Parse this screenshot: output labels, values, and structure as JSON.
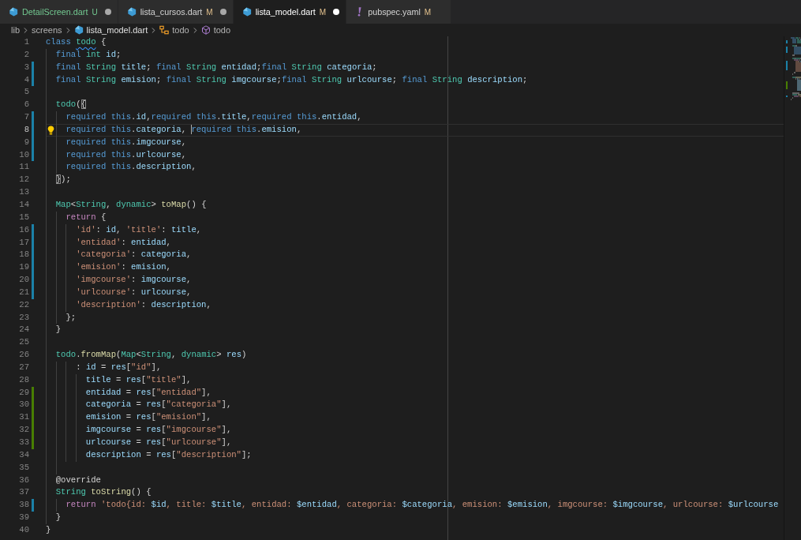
{
  "tabs": [
    {
      "kind": "dart",
      "label": "DetailScreen.dart",
      "status": "U",
      "untracked": true,
      "dirty": true,
      "selected": false
    },
    {
      "kind": "dart",
      "label": "lista_cursos.dart",
      "status": "M",
      "untracked": false,
      "dirty": true,
      "selected": false
    },
    {
      "kind": "dart",
      "label": "lista_model.dart",
      "status": "M",
      "untracked": false,
      "dirty": true,
      "selected": true
    },
    {
      "kind": "yaml",
      "label": "pubspec.yaml",
      "status": "M",
      "untracked": false,
      "dirty": false,
      "selected": false
    }
  ],
  "breadcrumb": [
    {
      "kind": "folder",
      "text": "lib"
    },
    {
      "kind": "folder",
      "text": "screens"
    },
    {
      "kind": "file",
      "text": "lista_model.dart"
    },
    {
      "kind": "class",
      "text": "todo"
    },
    {
      "kind": "constructor",
      "text": "todo"
    }
  ],
  "editor": {
    "lines": [
      {
        "number": "1",
        "kind": "plain",
        "current": false,
        "tokens": [
          {
            "kind": "kw",
            "text": "class "
          },
          {
            "kind": "type",
            "text": "todo",
            "squiggle": true
          },
          {
            "kind": "punct",
            "text": " {"
          }
        ]
      },
      {
        "number": "2",
        "kind": "plain",
        "current": false,
        "tokens": [
          {
            "kind": "kw",
            "text": "  final "
          },
          {
            "kind": "type",
            "text": "int "
          },
          {
            "kind": "var",
            "text": "id"
          },
          {
            "kind": "punct",
            "text": ";"
          }
        ]
      },
      {
        "number": "3",
        "kind": "modified",
        "current": false,
        "tokens": [
          {
            "kind": "kw",
            "text": "  final "
          },
          {
            "kind": "type",
            "text": "String "
          },
          {
            "kind": "var",
            "text": "title"
          },
          {
            "kind": "punct",
            "text": "; "
          },
          {
            "kind": "kw",
            "text": "final "
          },
          {
            "kind": "type",
            "text": "String "
          },
          {
            "kind": "var",
            "text": "entidad"
          },
          {
            "kind": "punct",
            "text": ";"
          },
          {
            "kind": "kw",
            "text": "final "
          },
          {
            "kind": "type",
            "text": "String "
          },
          {
            "kind": "var",
            "text": "categoria"
          },
          {
            "kind": "punct",
            "text": ";"
          }
        ]
      },
      {
        "number": "4",
        "kind": "modified",
        "current": false,
        "tokens": [
          {
            "kind": "kw",
            "text": "  final "
          },
          {
            "kind": "type",
            "text": "String "
          },
          {
            "kind": "var",
            "text": "emision"
          },
          {
            "kind": "punct",
            "text": "; "
          },
          {
            "kind": "kw",
            "text": "final "
          },
          {
            "kind": "type",
            "text": "String "
          },
          {
            "kind": "var",
            "text": "imgcourse"
          },
          {
            "kind": "punct",
            "text": ";"
          },
          {
            "kind": "kw",
            "text": "final "
          },
          {
            "kind": "type",
            "text": "String "
          },
          {
            "kind": "var",
            "text": "urlcourse"
          },
          {
            "kind": "punct",
            "text": "; "
          },
          {
            "kind": "kw",
            "text": "final "
          },
          {
            "kind": "type",
            "text": "String "
          },
          {
            "kind": "var",
            "text": "description"
          },
          {
            "kind": "punct",
            "text": ";"
          }
        ]
      },
      {
        "number": "5",
        "kind": "plain",
        "current": false
      },
      {
        "number": "6",
        "kind": "plain",
        "current": false,
        "tokens": [
          {
            "kind": "type",
            "text": "  todo"
          },
          {
            "kind": "punct",
            "text": "("
          },
          {
            "kind": "punct",
            "text": "{",
            "matched": true
          }
        ]
      },
      {
        "number": "7",
        "kind": "modified",
        "current": false,
        "tokens": [
          {
            "kind": "kw",
            "text": "    required this"
          },
          {
            "kind": "punct",
            "text": "."
          },
          {
            "kind": "var",
            "text": "id"
          },
          {
            "kind": "punct",
            "text": ","
          },
          {
            "kind": "kw",
            "text": "required this"
          },
          {
            "kind": "punct",
            "text": "."
          },
          {
            "kind": "var",
            "text": "title"
          },
          {
            "kind": "punct",
            "text": ","
          },
          {
            "kind": "kw",
            "text": "required this"
          },
          {
            "kind": "punct",
            "text": "."
          },
          {
            "kind": "var",
            "text": "entidad"
          },
          {
            "kind": "punct",
            "text": ","
          }
        ]
      },
      {
        "number": "8",
        "kind": "modified",
        "current": true,
        "lightbulb": true,
        "tokens": [
          {
            "kind": "kw",
            "text": "    required this"
          },
          {
            "kind": "punct",
            "text": "."
          },
          {
            "kind": "var",
            "text": "categoria"
          },
          {
            "kind": "punct",
            "text": ", "
          },
          {
            "kind": "kw",
            "text": "required this",
            "cursor": true
          },
          {
            "kind": "punct",
            "text": "."
          },
          {
            "kind": "var",
            "text": "emision"
          },
          {
            "kind": "punct",
            "text": ","
          }
        ]
      },
      {
        "number": "9",
        "kind": "modified",
        "current": false,
        "tokens": [
          {
            "kind": "kw",
            "text": "    required this"
          },
          {
            "kind": "punct",
            "text": "."
          },
          {
            "kind": "var",
            "text": "imgcourse"
          },
          {
            "kind": "punct",
            "text": ","
          }
        ]
      },
      {
        "number": "10",
        "kind": "modified",
        "current": false,
        "tokens": [
          {
            "kind": "kw",
            "text": "    required this"
          },
          {
            "kind": "punct",
            "text": "."
          },
          {
            "kind": "var",
            "text": "urlcourse"
          },
          {
            "kind": "punct",
            "text": ","
          }
        ]
      },
      {
        "number": "11",
        "kind": "plain",
        "current": false,
        "tokens": [
          {
            "kind": "kw",
            "text": "    required this"
          },
          {
            "kind": "punct",
            "text": "."
          },
          {
            "kind": "var",
            "text": "description"
          },
          {
            "kind": "punct",
            "text": ","
          }
        ]
      },
      {
        "number": "12",
        "kind": "plain",
        "current": false,
        "tokens": [
          {
            "kind": "punct",
            "text": "  }",
            "matched": true
          },
          {
            "kind": "punct",
            "text": ");"
          }
        ]
      },
      {
        "number": "13",
        "kind": "plain",
        "current": false
      },
      {
        "number": "14",
        "kind": "plain",
        "current": false,
        "tokens": [
          {
            "kind": "type",
            "text": "  Map"
          },
          {
            "kind": "punct",
            "text": "<"
          },
          {
            "kind": "type",
            "text": "String"
          },
          {
            "kind": "punct",
            "text": ", "
          },
          {
            "kind": "type",
            "text": "dynamic"
          },
          {
            "kind": "punct",
            "text": "> "
          },
          {
            "kind": "fn",
            "text": "toMap"
          },
          {
            "kind": "punct",
            "text": "() {"
          }
        ]
      },
      {
        "number": "15",
        "kind": "plain",
        "current": false,
        "tokens": [
          {
            "kind": "ctl",
            "text": "    return"
          },
          {
            "kind": "punct",
            "text": " {"
          }
        ]
      },
      {
        "number": "16",
        "kind": "modified",
        "current": false,
        "tokens": [
          {
            "kind": "str",
            "text": "      'id'"
          },
          {
            "kind": "punct",
            "text": ": "
          },
          {
            "kind": "var",
            "text": "id"
          },
          {
            "kind": "punct",
            "text": ", "
          },
          {
            "kind": "str",
            "text": "'title'"
          },
          {
            "kind": "punct",
            "text": ": "
          },
          {
            "kind": "var",
            "text": "title"
          },
          {
            "kind": "punct",
            "text": ","
          }
        ]
      },
      {
        "number": "17",
        "kind": "modified",
        "current": false,
        "tokens": [
          {
            "kind": "str",
            "text": "      'entidad'"
          },
          {
            "kind": "punct",
            "text": ": "
          },
          {
            "kind": "var",
            "text": "entidad"
          },
          {
            "kind": "punct",
            "text": ","
          }
        ]
      },
      {
        "number": "18",
        "kind": "modified",
        "current": false,
        "tokens": [
          {
            "kind": "str",
            "text": "      'categoria'"
          },
          {
            "kind": "punct",
            "text": ": "
          },
          {
            "kind": "var",
            "text": "categoria"
          },
          {
            "kind": "punct",
            "text": ","
          }
        ]
      },
      {
        "number": "19",
        "kind": "modified",
        "current": false,
        "tokens": [
          {
            "kind": "str",
            "text": "      'emision'"
          },
          {
            "kind": "punct",
            "text": ": "
          },
          {
            "kind": "var",
            "text": "emision"
          },
          {
            "kind": "punct",
            "text": ","
          }
        ]
      },
      {
        "number": "20",
        "kind": "modified",
        "current": false,
        "tokens": [
          {
            "kind": "str",
            "text": "      'imgcourse'"
          },
          {
            "kind": "punct",
            "text": ": "
          },
          {
            "kind": "var",
            "text": "imgcourse"
          },
          {
            "kind": "punct",
            "text": ","
          }
        ]
      },
      {
        "number": "21",
        "kind": "modified",
        "current": false,
        "tokens": [
          {
            "kind": "str",
            "text": "      'urlcourse'"
          },
          {
            "kind": "punct",
            "text": ": "
          },
          {
            "kind": "var",
            "text": "urlcourse"
          },
          {
            "kind": "punct",
            "text": ","
          }
        ]
      },
      {
        "number": "22",
        "kind": "plain",
        "current": false,
        "tokens": [
          {
            "kind": "str",
            "text": "      'description'"
          },
          {
            "kind": "punct",
            "text": ": "
          },
          {
            "kind": "var",
            "text": "description"
          },
          {
            "kind": "punct",
            "text": ","
          }
        ]
      },
      {
        "number": "23",
        "kind": "plain",
        "current": false,
        "tokens": [
          {
            "kind": "punct",
            "text": "    };"
          }
        ]
      },
      {
        "number": "24",
        "kind": "plain",
        "current": false,
        "tokens": [
          {
            "kind": "punct",
            "text": "  }"
          }
        ]
      },
      {
        "number": "25",
        "kind": "plain",
        "current": false
      },
      {
        "number": "26",
        "kind": "plain",
        "current": false,
        "tokens": [
          {
            "kind": "type",
            "text": "  todo"
          },
          {
            "kind": "punct",
            "text": "."
          },
          {
            "kind": "fn",
            "text": "fromMap"
          },
          {
            "kind": "punct",
            "text": "("
          },
          {
            "kind": "type",
            "text": "Map"
          },
          {
            "kind": "punct",
            "text": "<"
          },
          {
            "kind": "type",
            "text": "String"
          },
          {
            "kind": "punct",
            "text": ", "
          },
          {
            "kind": "type",
            "text": "dynamic"
          },
          {
            "kind": "punct",
            "text": "> "
          },
          {
            "kind": "var",
            "text": "res"
          },
          {
            "kind": "punct",
            "text": ")"
          }
        ]
      },
      {
        "number": "27",
        "kind": "plain",
        "current": false,
        "tokens": [
          {
            "kind": "punct",
            "text": "      : "
          },
          {
            "kind": "var",
            "text": "id"
          },
          {
            "kind": "punct",
            "text": " = "
          },
          {
            "kind": "var",
            "text": "res"
          },
          {
            "kind": "punct",
            "text": "["
          },
          {
            "kind": "str",
            "text": "\"id\""
          },
          {
            "kind": "punct",
            "text": "],"
          }
        ]
      },
      {
        "number": "28",
        "kind": "plain",
        "current": false,
        "tokens": [
          {
            "kind": "var",
            "text": "        title"
          },
          {
            "kind": "punct",
            "text": " = "
          },
          {
            "kind": "var",
            "text": "res"
          },
          {
            "kind": "punct",
            "text": "["
          },
          {
            "kind": "str",
            "text": "\"title\""
          },
          {
            "kind": "punct",
            "text": "],"
          }
        ]
      },
      {
        "number": "29",
        "kind": "added",
        "current": false,
        "tokens": [
          {
            "kind": "var",
            "text": "        entidad"
          },
          {
            "kind": "punct",
            "text": " = "
          },
          {
            "kind": "var",
            "text": "res"
          },
          {
            "kind": "punct",
            "text": "["
          },
          {
            "kind": "str",
            "text": "\"entidad\""
          },
          {
            "kind": "punct",
            "text": "],"
          }
        ]
      },
      {
        "number": "30",
        "kind": "added",
        "current": false,
        "tokens": [
          {
            "kind": "var",
            "text": "        categoria"
          },
          {
            "kind": "punct",
            "text": " = "
          },
          {
            "kind": "var",
            "text": "res"
          },
          {
            "kind": "punct",
            "text": "["
          },
          {
            "kind": "str",
            "text": "\"categoria\""
          },
          {
            "kind": "punct",
            "text": "],"
          }
        ]
      },
      {
        "number": "31",
        "kind": "added",
        "current": false,
        "tokens": [
          {
            "kind": "var",
            "text": "        emision"
          },
          {
            "kind": "punct",
            "text": " = "
          },
          {
            "kind": "var",
            "text": "res"
          },
          {
            "kind": "punct",
            "text": "["
          },
          {
            "kind": "str",
            "text": "\"emision\""
          },
          {
            "kind": "punct",
            "text": "],"
          }
        ]
      },
      {
        "number": "32",
        "kind": "added",
        "current": false,
        "tokens": [
          {
            "kind": "var",
            "text": "        imgcourse"
          },
          {
            "kind": "punct",
            "text": " = "
          },
          {
            "kind": "var",
            "text": "res"
          },
          {
            "kind": "punct",
            "text": "["
          },
          {
            "kind": "str",
            "text": "\"imgcourse\""
          },
          {
            "kind": "punct",
            "text": "],"
          }
        ]
      },
      {
        "number": "33",
        "kind": "added",
        "current": false,
        "tokens": [
          {
            "kind": "var",
            "text": "        urlcourse"
          },
          {
            "kind": "punct",
            "text": " = "
          },
          {
            "kind": "var",
            "text": "res"
          },
          {
            "kind": "punct",
            "text": "["
          },
          {
            "kind": "str",
            "text": "\"urlcourse\""
          },
          {
            "kind": "punct",
            "text": "],"
          }
        ]
      },
      {
        "number": "34",
        "kind": "plain",
        "current": false,
        "tokens": [
          {
            "kind": "var",
            "text": "        description"
          },
          {
            "kind": "punct",
            "text": " = "
          },
          {
            "kind": "var",
            "text": "res"
          },
          {
            "kind": "punct",
            "text": "["
          },
          {
            "kind": "str",
            "text": "\"description\""
          },
          {
            "kind": "punct",
            "text": "];"
          }
        ]
      },
      {
        "number": "35",
        "kind": "plain",
        "current": false
      },
      {
        "number": "36",
        "kind": "plain",
        "current": false,
        "tokens": [
          {
            "kind": "punct",
            "text": "  @override"
          }
        ]
      },
      {
        "number": "37",
        "kind": "plain",
        "current": false,
        "tokens": [
          {
            "kind": "type",
            "text": "  String "
          },
          {
            "kind": "fn",
            "text": "toString"
          },
          {
            "kind": "punct",
            "text": "() {"
          }
        ]
      },
      {
        "number": "38",
        "kind": "modified",
        "current": false,
        "tokens": [
          {
            "kind": "ctl",
            "text": "    return "
          },
          {
            "kind": "str",
            "text": "'todo{id: "
          },
          {
            "kind": "var",
            "text": "$id"
          },
          {
            "kind": "str",
            "text": ", title: "
          },
          {
            "kind": "var",
            "text": "$title"
          },
          {
            "kind": "str",
            "text": ", entidad: "
          },
          {
            "kind": "var",
            "text": "$entidad"
          },
          {
            "kind": "str",
            "text": ", categoria: "
          },
          {
            "kind": "var",
            "text": "$categoria"
          },
          {
            "kind": "str",
            "text": ", emision: "
          },
          {
            "kind": "var",
            "text": "$emision"
          },
          {
            "kind": "str",
            "text": ", imgcourse: "
          },
          {
            "kind": "var",
            "text": "$imgcourse"
          },
          {
            "kind": "str",
            "text": ", urlcourse: "
          },
          {
            "kind": "var",
            "text": "$urlcourse"
          }
        ]
      },
      {
        "number": "39",
        "kind": "plain",
        "current": false,
        "tokens": [
          {
            "kind": "punct",
            "text": "  }"
          }
        ]
      },
      {
        "number": "40",
        "kind": "plain",
        "current": false,
        "tokens": [
          {
            "kind": "punct",
            "text": "}"
          }
        ]
      }
    ]
  }
}
